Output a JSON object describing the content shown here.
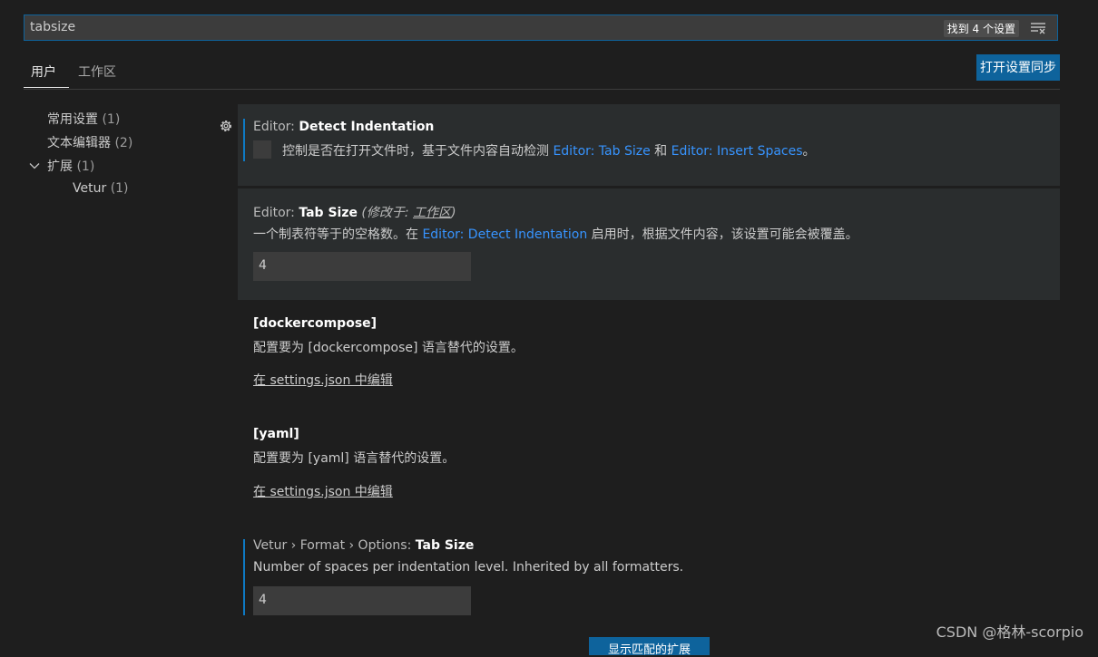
{
  "search": {
    "value": "tabsize",
    "results_badge": "找到 4 个设置"
  },
  "tabs": [
    {
      "label": "用户",
      "active": true
    },
    {
      "label": "工作区",
      "active": false
    }
  ],
  "sync_button_label": "打开设置同步",
  "toc": {
    "items": [
      {
        "label": "常用设置",
        "count": "(1)"
      },
      {
        "label": "文本编辑器",
        "count": "(2)"
      },
      {
        "label": "扩展",
        "count": "(1)"
      },
      {
        "label": "Vetur",
        "count": "(1)"
      }
    ]
  },
  "settings": {
    "detect_indentation": {
      "category": "Editor: ",
      "name": "Detect Indentation",
      "desc_prefix": "控制是否在打开文件时，基于文件内容自动检测 ",
      "link1": "Editor: Tab Size",
      "desc_mid": " 和 ",
      "link2": "Editor: Insert Spaces",
      "desc_suffix": "。",
      "checked": false
    },
    "tab_size": {
      "category": "Editor: ",
      "name": "Tab Size",
      "modified_prefix": " (修改于: ",
      "modified_scope": "工作区",
      "modified_suffix": ")",
      "desc_prefix": "一个制表符等于的空格数。在 ",
      "link": "Editor: Detect Indentation",
      "desc_suffix": " 启用时，根据文件内容，该设置可能会被覆盖。",
      "value": "4"
    },
    "dockercompose": {
      "title": "[dockercompose]",
      "desc": "配置要为 [dockercompose] 语言替代的设置。",
      "edit_link": "在 settings.json 中编辑"
    },
    "yaml": {
      "title": "[yaml]",
      "desc": "配置要为 [yaml] 语言替代的设置。",
      "edit_link": "在 settings.json 中编辑"
    },
    "vetur_tab_size": {
      "category": "Vetur › Format › Options: ",
      "name": "Tab Size",
      "desc": "Number of spaces per indentation level. Inherited by all formatters.",
      "value": "4"
    }
  },
  "bottom_button_label": "显示匹配的扩展",
  "watermark": "CSDN @格林-scorpio"
}
